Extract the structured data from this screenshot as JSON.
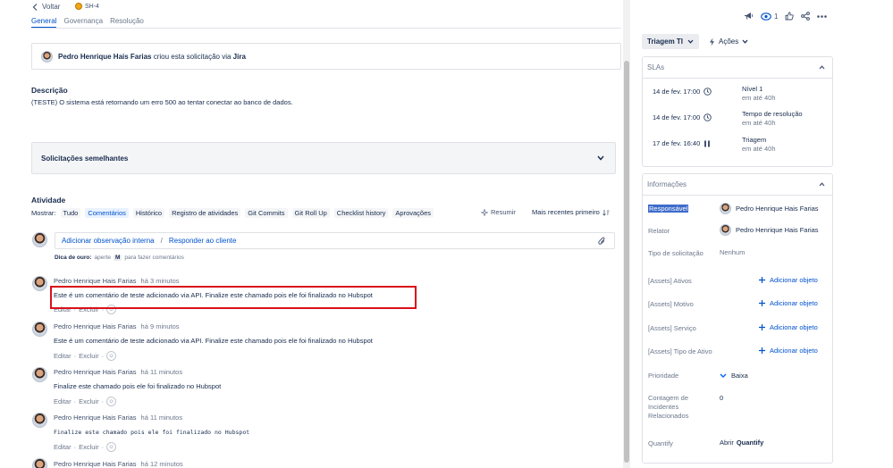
{
  "nav": {
    "back_label": "Voltar",
    "issue_key": "SH-4",
    "tabs": [
      "General",
      "Governança",
      "Resolução"
    ]
  },
  "created": {
    "author": "Pedro Henrique Hais Farias",
    "text": "criou esta solicitação via",
    "channel": "Jira"
  },
  "description": {
    "title": "Descrição",
    "text": "(TESTE) O sistema está retornando um erro 500 ao tentar conectar ao banco de dados."
  },
  "similar": {
    "title": "Solicitações semelhantes"
  },
  "activity": {
    "title": "Atividade",
    "show_label": "Mostrar:",
    "filters": [
      "Tudo",
      "Comentários",
      "Histórico",
      "Registro de atividades",
      "Git Commits",
      "Git Roll Up",
      "Checklist history",
      "Aprovações"
    ],
    "active_filter": "Comentários",
    "summarize": "Resumir",
    "sort": "Mais recentes primeiro"
  },
  "composer": {
    "internal": "Adicionar observação interna",
    "separator": "/",
    "reply": "Responder ao cliente",
    "tip_bold": "Dica de ouro:",
    "tip_pre": "aperte",
    "tip_key": "M",
    "tip_post": "para fazer comentários"
  },
  "comments": [
    {
      "author": "Pedro Henrique Hais Farias",
      "when": "há 3 minutos",
      "body": "Este é um comentário de teste adicionado via API. Finalize este chamado pois ele foi finalizado no Hubspot",
      "edit": "Editar",
      "delete": "Excluir"
    },
    {
      "author": "Pedro Henrique Hais Farias",
      "when": "há 9 minutos",
      "body": "Este é um comentário de teste adicionado via API. Finalize este chamado pois ele foi finalizado no Hubspot",
      "edit": "Editar",
      "delete": "Excluir"
    },
    {
      "author": "Pedro Henrique Hais Farias",
      "when": "há 11 minutos",
      "body": "Finalize este chamado pois ele foi finalizado no Hubspot",
      "edit": "Editar",
      "delete": "Excluir"
    },
    {
      "author": "Pedro Henrique Hais Farias",
      "when": "há 11 minutos",
      "body": "Finalize este chamado pois ele foi finalizado no Hubspot",
      "edit": "Editar",
      "delete": "Excluir"
    },
    {
      "author": "Pedro Henrique Hais Farias",
      "when": "há 12 minutos"
    }
  ],
  "right": {
    "watchers": "1",
    "status": "Triagem TI",
    "actions": "Ações",
    "slas_title": "SLAs",
    "slas": [
      {
        "date": "14 de fev. 17:00",
        "name": "Nível 1",
        "sub": "em até 40h"
      },
      {
        "date": "14 de fev. 17:00",
        "name": "Tempo de resolução",
        "sub": "em até 40h"
      },
      {
        "date": "17 de fev. 16:40",
        "name": "Triagem",
        "sub": "em até 40h"
      }
    ],
    "info_title": "Informações",
    "info": {
      "responsavel_label": "Responsável",
      "responsavel_value": "Pedro Henrique Hais Farias",
      "relator_label": "Relator",
      "relator_value": "Pedro Henrique Hais Farias",
      "tipo_label": "Tipo de solicitação",
      "tipo_value": "Nenhum",
      "ativos_label": "[Assets] Ativos",
      "motivo_label": "[Assets] Motivo",
      "servico_label": "[Assets] Serviço",
      "tipoativo_label": "[Assets] Tipo de Ativo",
      "add_object": "Adicionar objeto",
      "prioridade_label": "Prioridade",
      "prioridade_value": "Baixa",
      "contagem_label": "Contagem de Incidentes Relacionados",
      "contagem_value": "0",
      "quantify_label": "Quantify",
      "quantify_pre": "Abrir",
      "quantify_bold": "Quantify"
    }
  }
}
